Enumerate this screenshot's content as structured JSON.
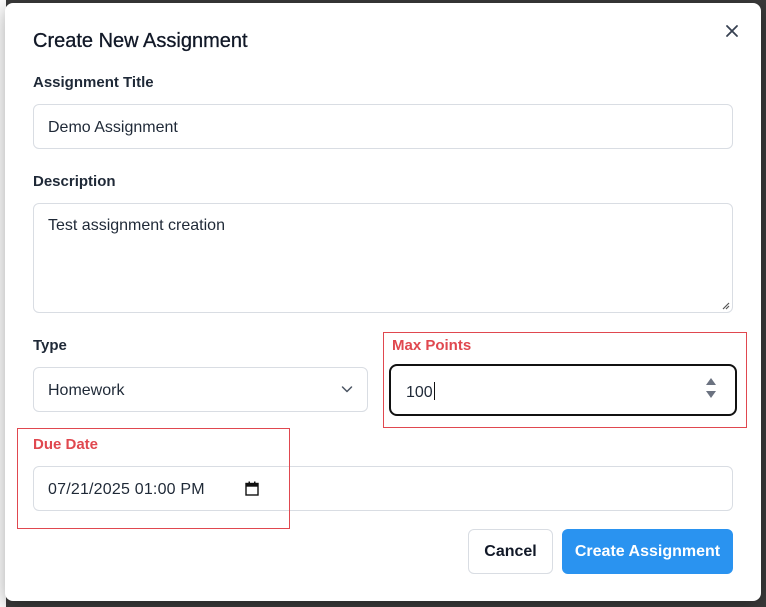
{
  "dialog": {
    "title": "Create New Assignment",
    "close_icon": "close-icon"
  },
  "form": {
    "title_label": "Assignment Title",
    "title_value": "Demo Assignment",
    "description_label": "Description",
    "description_value": "Test assignment creation",
    "type_label": "Type",
    "type_value": "Homework",
    "max_points_label": "Max Points",
    "max_points_value": "100",
    "due_date_label": "Due Date",
    "due_date_value": "07/21/2025 01:00 PM"
  },
  "buttons": {
    "cancel": "Cancel",
    "create": "Create Assignment"
  },
  "colors": {
    "primary": "#2a93f0",
    "error": "#e0484f",
    "border": "#d9dde3"
  }
}
